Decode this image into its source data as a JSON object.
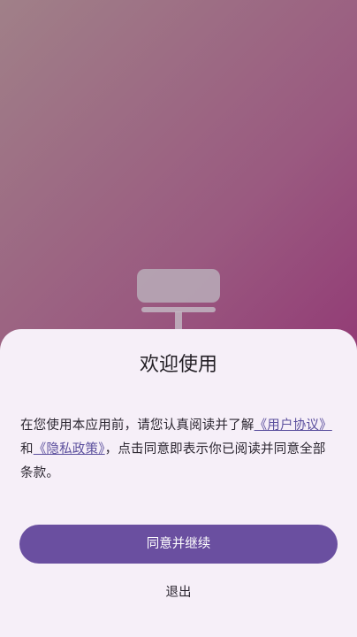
{
  "dialog": {
    "title": "欢迎使用",
    "text_before": "在您使用本应用前，请您认真阅读并了解",
    "user_agreement_link": "《用户协议》",
    "text_and": "和",
    "privacy_policy_link": "《隐私政策》",
    "text_after": "，点击同意即表示你已阅读并同意全部条款。",
    "agree_button": "同意并继续",
    "exit_button": "退出"
  },
  "colors": {
    "primary": "#6a4fa0",
    "link": "#5b4f9d",
    "sheet_background": "#f6eff8",
    "splash_gradient_start": "#a08088",
    "splash_gradient_end": "#8a1a6a"
  },
  "icons": {
    "splash": "desk-lamp-icon"
  }
}
